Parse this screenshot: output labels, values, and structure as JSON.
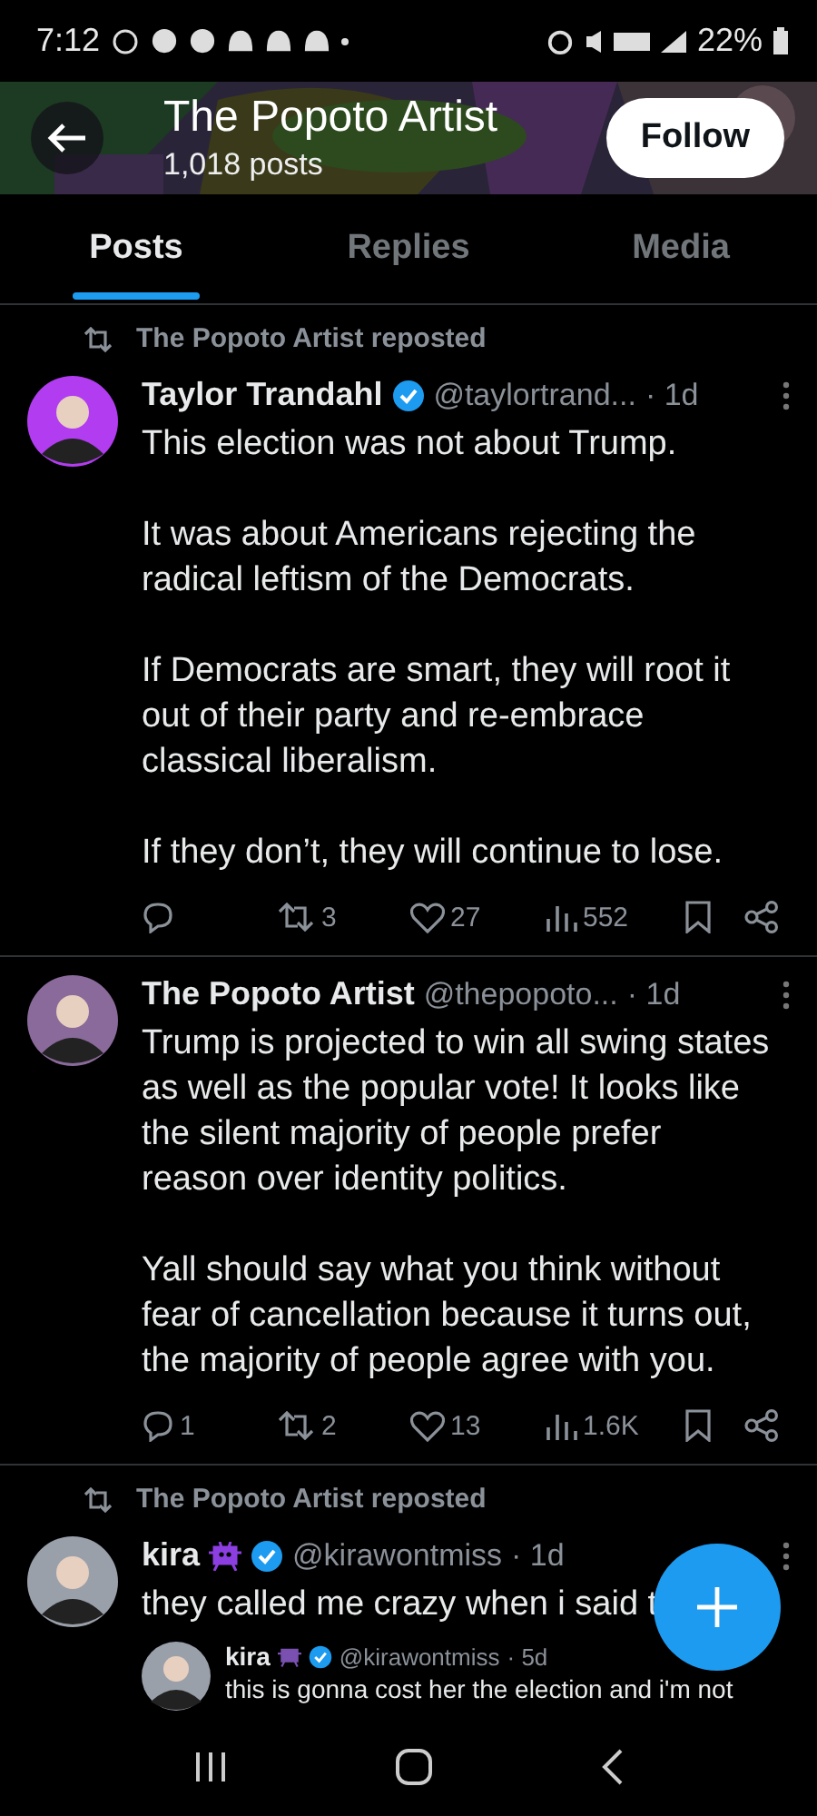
{
  "status_bar": {
    "time": "7:12",
    "battery": "22%"
  },
  "header": {
    "title": "The Popoto Artist",
    "subtitle": "1,018 posts",
    "follow_button": "Follow"
  },
  "tabs": [
    {
      "label": "Posts",
      "selected": true
    },
    {
      "label": "Replies",
      "selected": false
    },
    {
      "label": "Media",
      "selected": false
    }
  ],
  "posts": [
    {
      "repost_label": "The Popoto Artist reposted",
      "name": "Taylor Trandahl",
      "verified": true,
      "emoji_badge": false,
      "handle": "@taylortrand...",
      "time": "· 1d",
      "paragraphs": [
        "This election was not about Trump.",
        "It was about Americans rejecting the radical leftism of the Democrats.",
        "If Democrats are smart, they will root it out of their party and re-embrace classical liberalism.",
        "If they don’t, they will continue to lose."
      ],
      "stats": {
        "reposts": "3",
        "likes": "27",
        "views": "552"
      }
    },
    {
      "name": "The Popoto Artist",
      "verified": false,
      "emoji_badge": false,
      "handle": "@thepopoto...",
      "time": "· 1d",
      "paragraphs": [
        "Trump is projected to win all swing states as well as the popular vote! It looks like the silent majority of people prefer reason over identity politics.",
        "Yall should say what you think without fear of cancellation because it turns out, the majority of people agree with you."
      ],
      "stats": {
        "replies": "1",
        "reposts": "2",
        "likes": "13",
        "views": "1.6K"
      }
    },
    {
      "repost_label": "The Popoto Artist reposted",
      "name": "kira",
      "verified": true,
      "emoji_badge": true,
      "handle": "@kirawontmiss",
      "time": "· 1d",
      "paragraphs": [
        "they called me crazy when i said t"
      ],
      "quote": {
        "name": "kira",
        "verified": true,
        "emoji_badge": true,
        "handle": "@kirawontmiss",
        "time": "· 5d",
        "text": "this is gonna cost her the election and i'm not"
      }
    }
  ]
}
